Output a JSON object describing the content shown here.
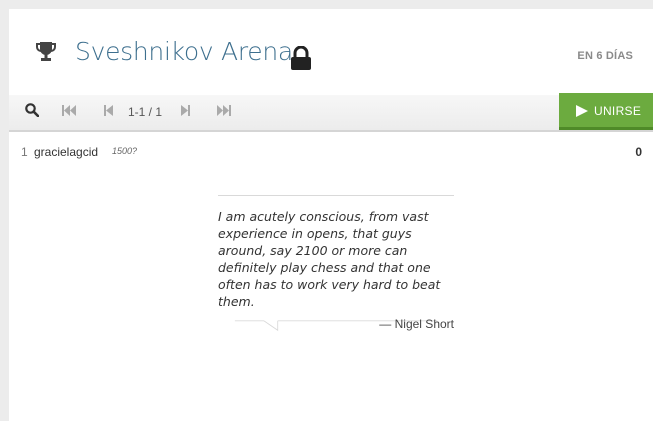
{
  "header": {
    "title": "Sveshnikov Arena",
    "starts_in": "EN 6 DÍAS",
    "icons": {
      "trophy": "trophy-icon",
      "lock": "lock-icon"
    }
  },
  "toolbar": {
    "pager": "1-1 / 1",
    "icons": [
      "search-icon",
      "first-page-icon",
      "prev-page-icon",
      "next-page-icon",
      "last-page-icon"
    ]
  },
  "join_button": {
    "label": "UNIRSE",
    "color": "#6cab3f"
  },
  "standings": [
    {
      "rank": "1",
      "player": "gracielagcid",
      "rating": "1500?",
      "score": "0"
    }
  ],
  "quote": {
    "text": "I am acutely conscious, from vast experience in opens, that guys around, say 2100 or more can definitely play chess and that one often has to work very hard to beat them.",
    "author": "— Nigel Short"
  },
  "colors": {
    "title": "#3d6f8e",
    "accent": "#6cab3f"
  }
}
